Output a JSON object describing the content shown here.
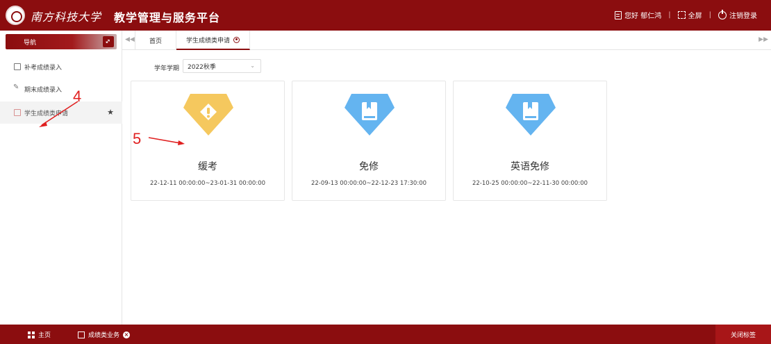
{
  "header": {
    "university": "南方科技大学",
    "system_title": "教学管理与服务平台",
    "greeting": "您好 郁仁鸿",
    "fullscreen": "全屏",
    "logout": "注销登录"
  },
  "sidebar": {
    "nav_title": "导航",
    "items": [
      {
        "label": "补考成绩录入",
        "icon": "document-icon"
      },
      {
        "label": "期末成绩录入",
        "icon": "pen-icon"
      },
      {
        "label": "学生成绩类申请",
        "icon": "document-icon",
        "active": true,
        "starred": true
      }
    ]
  },
  "tabs": {
    "home": "首页",
    "active": "学生成绩类申请"
  },
  "filter": {
    "label": "学年学期",
    "term_value": "2022秋季"
  },
  "cards": [
    {
      "title": "缓考",
      "time": "22-12-11 00:00:00~23-01-31 00:00:00",
      "icon": "warning-icon",
      "color": "#f5c85e"
    },
    {
      "title": "免修",
      "time": "22-09-13 00:00:00~22-12-23 17:30:00",
      "icon": "book-icon",
      "color": "#64b4f0"
    },
    {
      "title": "英语免修",
      "time": "22-10-25 00:00:00~22-11-30 00:00:00",
      "icon": "book-icon",
      "color": "#64b4f0"
    }
  ],
  "annotations": {
    "step4": "4",
    "step5": "5"
  },
  "footer": {
    "home": "主页",
    "business_tab": "成绩类业务",
    "close_tabs": "关闭标签"
  },
  "colors": {
    "brand": "#8b0d0f",
    "annotation": "#e02020"
  }
}
